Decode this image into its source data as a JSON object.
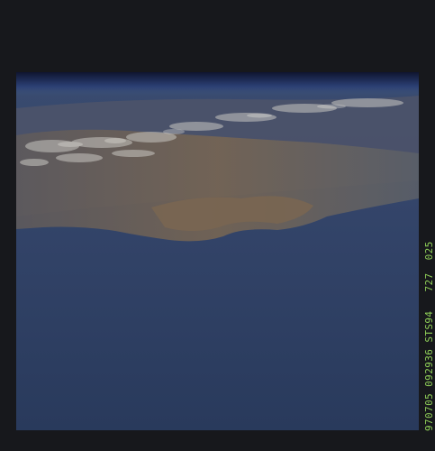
{
  "photo": {
    "frame_code": "970705 092936 STS94   727  025",
    "colors": {
      "border": "#17181c",
      "space": "#151d35",
      "ocean": "#2e3f62",
      "land": "#6d6155",
      "clouds": "#c9c7c2",
      "film_text": "#8fcf58"
    }
  }
}
